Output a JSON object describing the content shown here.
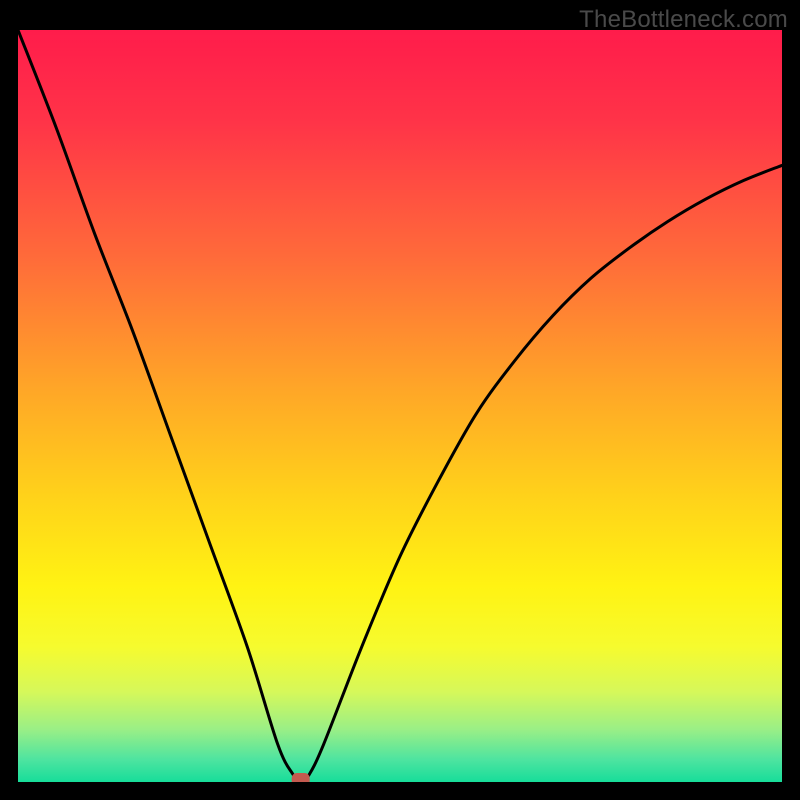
{
  "watermark": "TheBottleneck.com",
  "chart_data": {
    "type": "line",
    "title": "",
    "xlabel": "",
    "ylabel": "",
    "xlim": [
      0,
      100
    ],
    "ylim": [
      0,
      100
    ],
    "curve_desc": "Bottleneck percentage curve: steep descent from top-left, flat minimum near x≈37, rising convex toward upper-right",
    "x": [
      0,
      5,
      10,
      15,
      20,
      25,
      30,
      34,
      36,
      37,
      38,
      40,
      45,
      50,
      55,
      60,
      65,
      70,
      75,
      80,
      85,
      90,
      95,
      100
    ],
    "y": [
      100,
      87,
      73,
      60,
      46,
      32,
      18,
      5,
      1,
      0,
      0.8,
      5,
      18,
      30,
      40,
      49,
      56,
      62,
      67,
      71,
      74.5,
      77.5,
      80,
      82
    ],
    "minimum_marker": {
      "x": 37,
      "y": 0
    },
    "background_gradient_stops": [
      {
        "pos": 0.0,
        "color": "#ff1c4b"
      },
      {
        "pos": 0.12,
        "color": "#ff3348"
      },
      {
        "pos": 0.3,
        "color": "#ff6a3a"
      },
      {
        "pos": 0.48,
        "color": "#ffa727"
      },
      {
        "pos": 0.62,
        "color": "#ffd21a"
      },
      {
        "pos": 0.74,
        "color": "#fff313"
      },
      {
        "pos": 0.82,
        "color": "#f6fb2e"
      },
      {
        "pos": 0.88,
        "color": "#d6f85a"
      },
      {
        "pos": 0.93,
        "color": "#9aef86"
      },
      {
        "pos": 0.97,
        "color": "#4ee4a0"
      },
      {
        "pos": 1.0,
        "color": "#17dd9a"
      }
    ]
  }
}
